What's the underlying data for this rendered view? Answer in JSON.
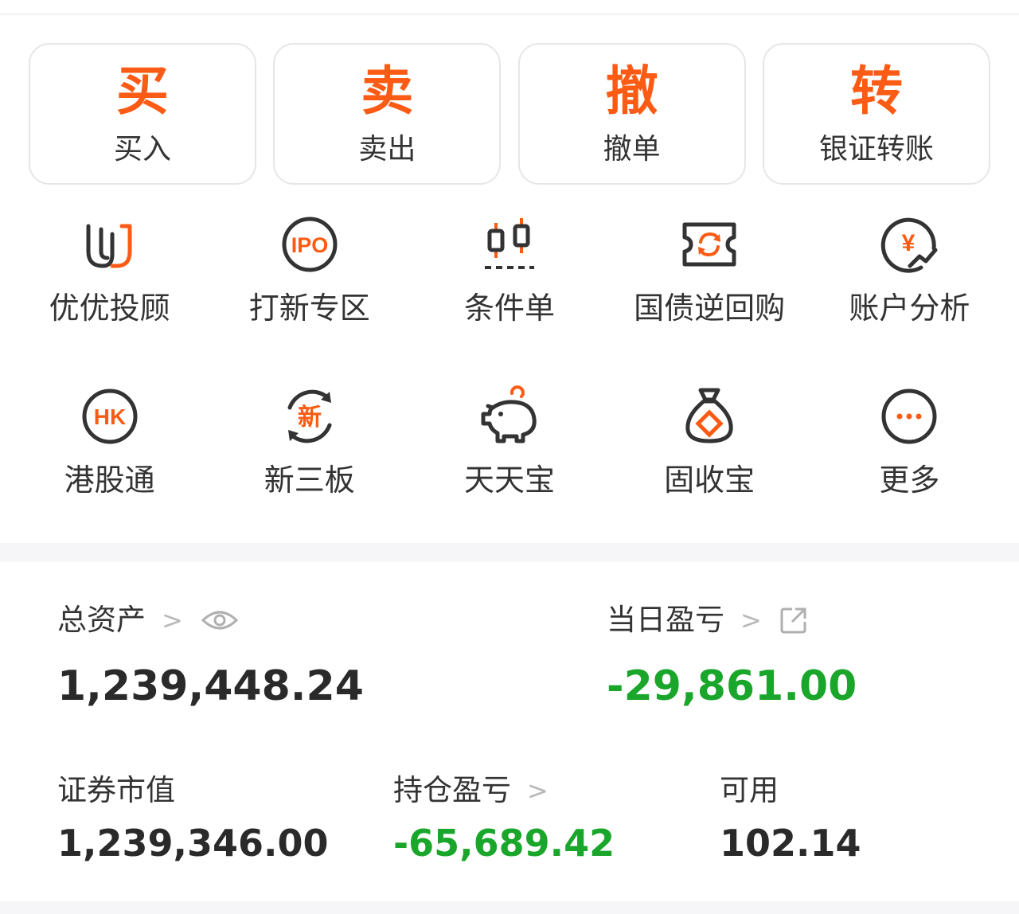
{
  "colors": {
    "accent": "#fb5b14",
    "negative": "#1aa62a",
    "text": "#2a2a2a"
  },
  "trade_buttons": [
    {
      "big": "买",
      "label": "买入"
    },
    {
      "big": "卖",
      "label": "卖出"
    },
    {
      "big": "撤",
      "label": "撤单"
    },
    {
      "big": "转",
      "label": "银证转账"
    }
  ],
  "grid_row1": [
    {
      "label": "优优投顾",
      "icon": "uu-advisor-icon"
    },
    {
      "label": "打新专区",
      "icon": "ipo-icon",
      "icon_text": "IPO"
    },
    {
      "label": "条件单",
      "icon": "candlestick-icon"
    },
    {
      "label": "国债逆回购",
      "icon": "ticket-refresh-icon"
    },
    {
      "label": "账户分析",
      "icon": "yuan-chart-icon",
      "icon_text": "¥"
    }
  ],
  "grid_row2": [
    {
      "label": "港股通",
      "icon": "hk-icon",
      "icon_text": "HK"
    },
    {
      "label": "新三板",
      "icon": "new-board-icon",
      "icon_text": "新"
    },
    {
      "label": "天天宝",
      "icon": "piggy-bank-icon"
    },
    {
      "label": "固收宝",
      "icon": "money-bag-icon"
    },
    {
      "label": "更多",
      "icon": "more-icon"
    }
  ],
  "assets": {
    "total_label": "总资产",
    "total_value": "1,239,448.24",
    "daily_pl_label": "当日盈亏",
    "daily_pl_value": "-29,861.00",
    "market_value_label": "证券市值",
    "market_value": "1,239,346.00",
    "position_pl_label": "持仓盈亏",
    "position_pl_value": "-65,689.42",
    "available_label": "可用",
    "available_value": "102.14",
    "chevron": ">"
  }
}
